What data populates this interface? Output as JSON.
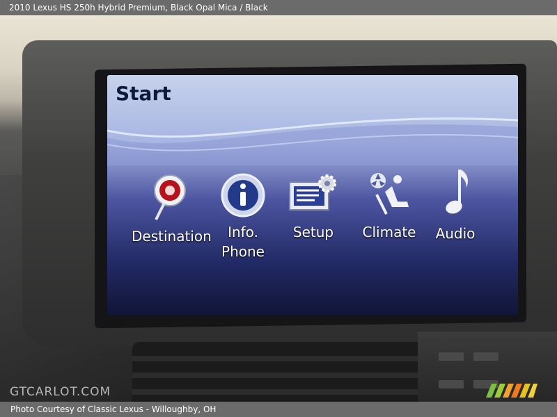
{
  "header": {
    "caption": "2010 Lexus HS 250h Hybrid Premium,  Black Opal Mica / Black"
  },
  "screen": {
    "title": "Start",
    "items": [
      {
        "label": "Destination",
        "icon": "destination-pin-icon"
      },
      {
        "label": "Info.\nPhone",
        "icon": "info-icon"
      },
      {
        "label": "Setup",
        "icon": "setup-gear-icon"
      },
      {
        "label": "Climate",
        "icon": "climate-seat-fan-icon"
      },
      {
        "label": "Audio",
        "icon": "music-note-icon"
      }
    ]
  },
  "watermark": "GTCARLOT.COM",
  "footer": {
    "credit": "Photo Courtesy of Classic Lexus - Willoughby, OH"
  },
  "colors": {
    "bar": "#6b6b6b",
    "screen_top": "#c7d2ec",
    "screen_bottom": "#121536"
  }
}
